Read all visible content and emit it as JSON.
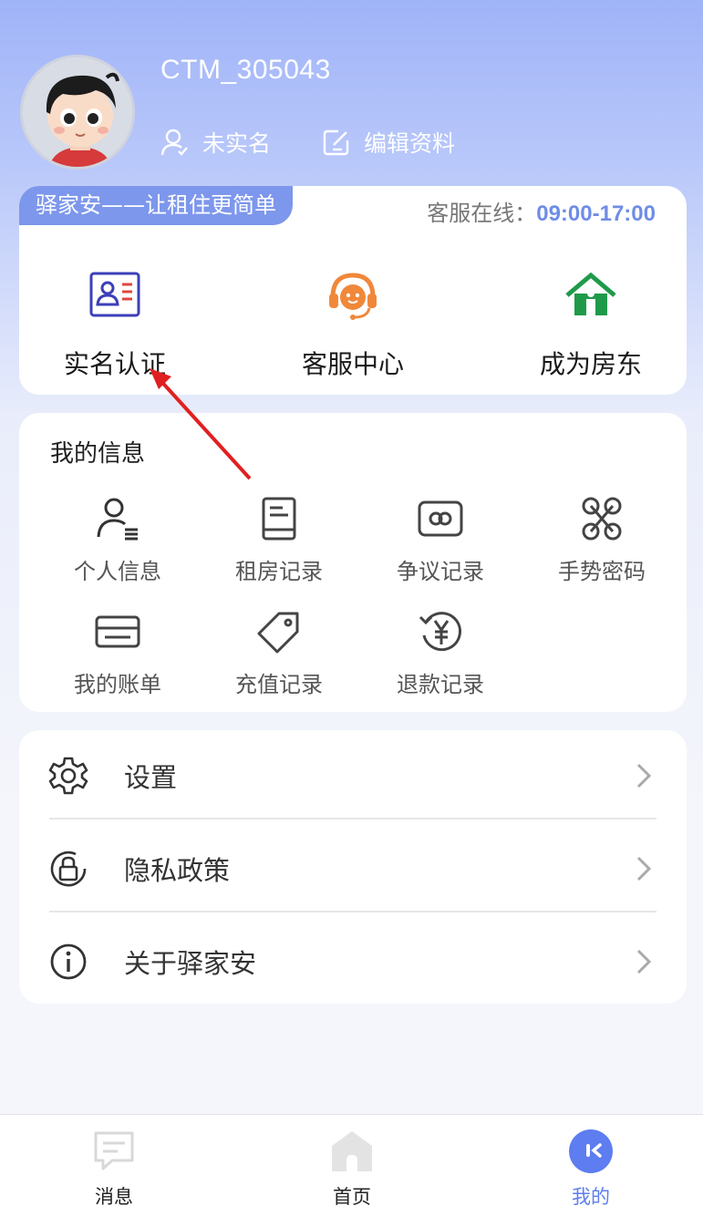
{
  "profile": {
    "username": "CTM_305043",
    "verify_status": "未实名",
    "edit_label": "编辑资料"
  },
  "service_card": {
    "slogan": "驿家安——让租住更简单",
    "hours_label": "客服在线：",
    "hours_time": "09:00-17:00",
    "items": [
      {
        "label": "实名认证",
        "icon": "id-card-icon"
      },
      {
        "label": "客服中心",
        "icon": "headset-icon"
      },
      {
        "label": "成为房东",
        "icon": "house-icon"
      }
    ]
  },
  "my_info": {
    "title": "我的信息",
    "items": [
      {
        "label": "个人信息",
        "icon": "personal-info-icon"
      },
      {
        "label": "租房记录",
        "icon": "rental-record-icon"
      },
      {
        "label": "争议记录",
        "icon": "dispute-record-icon"
      },
      {
        "label": "手势密码",
        "icon": "gesture-password-icon"
      },
      {
        "label": "我的账单",
        "icon": "bill-icon"
      },
      {
        "label": "充值记录",
        "icon": "recharge-icon"
      },
      {
        "label": "退款记录",
        "icon": "refund-icon"
      }
    ]
  },
  "menu": [
    {
      "label": "设置",
      "icon": "gear-icon"
    },
    {
      "label": "隐私政策",
      "icon": "privacy-lock-icon"
    },
    {
      "label": "关于驿家安",
      "icon": "info-icon"
    }
  ],
  "tabbar": [
    {
      "label": "消息",
      "icon": "message-icon"
    },
    {
      "label": "首页",
      "icon": "home-icon"
    },
    {
      "label": "我的",
      "icon": "mine-icon",
      "active": true
    }
  ],
  "colors": {
    "accent": "#5d7df0",
    "slogan_bg": "#7d97ec",
    "headset": "#f0883a",
    "house": "#1f9a4a",
    "annotation": "#e02020"
  }
}
